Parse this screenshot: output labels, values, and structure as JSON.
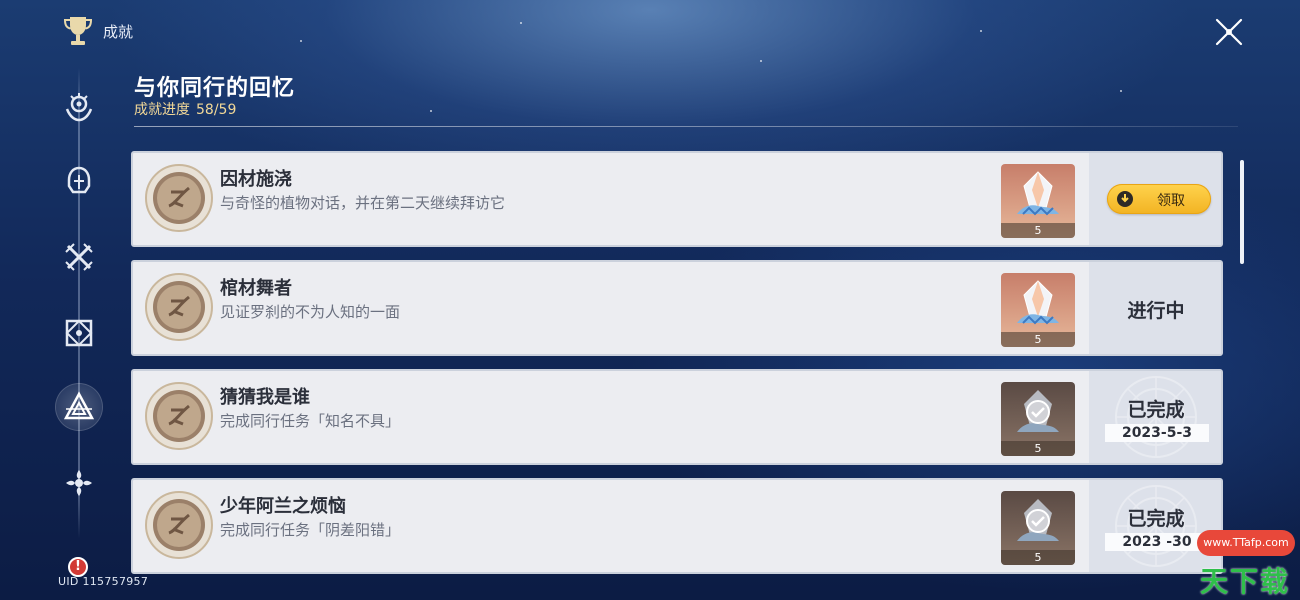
{
  "header": {
    "title": "成就"
  },
  "category": {
    "title": "与你同行的回忆",
    "progress_label": "成就进度",
    "progress_value": "58/59"
  },
  "sidebar": {
    "items": [
      {
        "icon": "wonders-of-the-world-icon",
        "active": false
      },
      {
        "icon": "knight-helmet-icon",
        "active": false
      },
      {
        "icon": "crossed-swords-icon",
        "active": false
      },
      {
        "icon": "geometric-emblem-icon",
        "active": false
      },
      {
        "icon": "triangle-emblem-icon",
        "active": true
      },
      {
        "icon": "flower-emblem-icon",
        "active": false
      }
    ],
    "alert_badge": "!",
    "uid_text": "UID 115757957"
  },
  "achievements": [
    {
      "name": "因材施浇",
      "desc": "与奇怪的植物对话，并在第二天继续拜访它",
      "reward_qty": "5",
      "status": "claim",
      "action_label": "领取"
    },
    {
      "name": "棺材舞者",
      "desc": "见证罗刹的不为人知的一面",
      "reward_qty": "5",
      "status": "in_progress",
      "status_label": "进行中"
    },
    {
      "name": "猜猜我是谁",
      "desc": "完成同行任务「知名不具」",
      "reward_qty": "5",
      "status": "completed",
      "status_label": "已完成",
      "date": "2023-5-3"
    },
    {
      "name": "少年阿兰之烦恼",
      "desc": "完成同行任务「阴差阳错」",
      "reward_qty": "5",
      "status": "completed",
      "status_label": "已完成",
      "date": "2023 -30"
    }
  ],
  "watermark": {
    "url": "www.TTafp.com",
    "brand": "天下载",
    "big": "天"
  },
  "colors": {
    "accent": "#f2b323",
    "progress_gold": "#f2d897",
    "card_bg": "#ecedf1",
    "status_bg": "#dde1ea"
  }
}
